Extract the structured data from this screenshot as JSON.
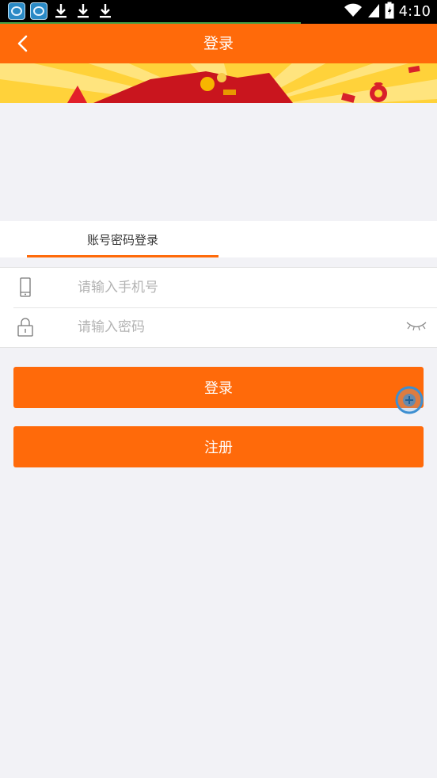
{
  "status_bar": {
    "time": "4:10",
    "left_icons": [
      "app-icon",
      "app-icon",
      "download-icon",
      "download-icon",
      "download-icon"
    ],
    "right_icons": [
      "wifi-icon",
      "signal-icon",
      "battery-icon"
    ]
  },
  "header": {
    "title": "登录",
    "back_icon": "chevron-left-icon"
  },
  "banner": {
    "icons": [
      "red-envelope-icon",
      "money-bag-icon"
    ]
  },
  "tabs": {
    "active_label": "账号密码登录"
  },
  "form": {
    "phone": {
      "placeholder": "请输入手机号",
      "value": "",
      "icon": "phone-icon"
    },
    "password": {
      "placeholder": "请输入密码",
      "value": "",
      "icon": "lock-icon",
      "toggle_icon": "eye-closed-icon"
    }
  },
  "buttons": {
    "login_label": "登录",
    "register_label": "注册"
  },
  "colors": {
    "accent": "#ff6a0a",
    "background": "#f2f2f6",
    "banner_yellow": "#ffd23a",
    "banner_red": "#c9151e"
  }
}
